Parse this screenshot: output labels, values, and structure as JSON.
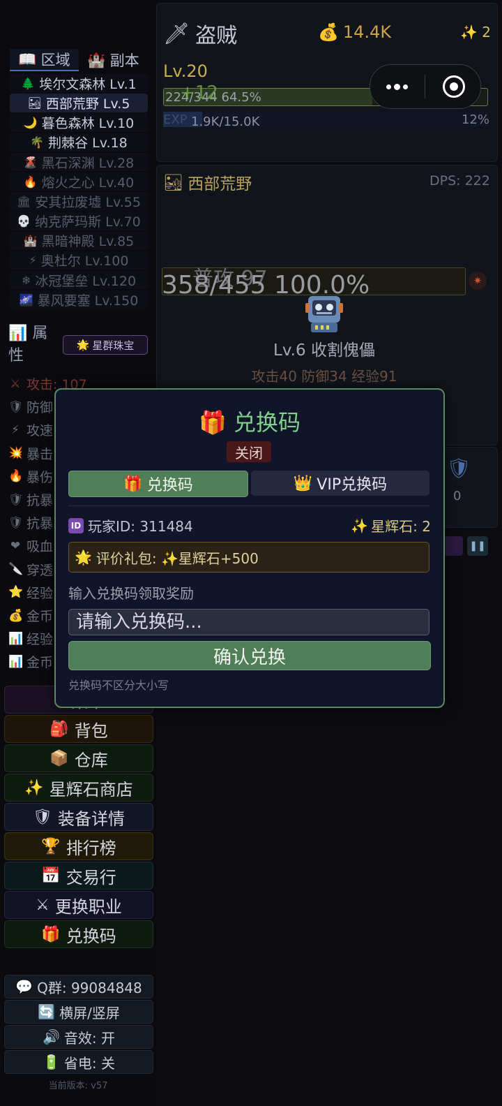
{
  "zone_tabs": [
    {
      "icon": "📖",
      "label": "区域"
    },
    {
      "icon": "🏰",
      "label": "副本"
    }
  ],
  "zones": [
    {
      "icon": "🌲",
      "label": "埃尔文森林 Lv.1",
      "state": "normal"
    },
    {
      "icon": "🏜",
      "label": "西部荒野 Lv.5",
      "state": "active"
    },
    {
      "icon": "🌙",
      "label": "暮色森林 Lv.10",
      "state": "normal"
    },
    {
      "icon": "🌴",
      "label": "荆棘谷 Lv.18",
      "state": "normal"
    },
    {
      "icon": "🌋",
      "label": "黑石深渊 Lv.28",
      "state": "locked"
    },
    {
      "icon": "🔥",
      "label": "熔火之心 Lv.40",
      "state": "locked"
    },
    {
      "icon": "🏛",
      "label": "安其拉废墟 Lv.55",
      "state": "locked"
    },
    {
      "icon": "💀",
      "label": "纳克萨玛斯 Lv.70",
      "state": "locked"
    },
    {
      "icon": "🏰",
      "label": "黑暗神殿 Lv.85",
      "state": "locked"
    },
    {
      "icon": "⚡",
      "label": "奥杜尔 Lv.100",
      "state": "locked"
    },
    {
      "icon": "❄",
      "label": "冰冠堡垒 Lv.120",
      "state": "locked"
    },
    {
      "icon": "🌌",
      "label": "暴风要塞 Lv.150",
      "state": "locked"
    }
  ],
  "attributes": {
    "title": "属性",
    "gem_button": "星群珠宝",
    "stats": [
      {
        "icon": "⚔",
        "label": "攻击: 107",
        "color": "#7a3a34"
      },
      {
        "icon": "🛡",
        "label": "防御",
        "color": "#6a6e7a"
      },
      {
        "icon": "⚡",
        "label": "攻速",
        "color": "#6a6e7a"
      },
      {
        "icon": "💥",
        "label": "暴击",
        "color": "#6a6e7a"
      },
      {
        "icon": "🔥",
        "label": "暴伤",
        "color": "#6a6e7a"
      },
      {
        "icon": "🛡",
        "label": "抗暴",
        "color": "#6a6e7a"
      },
      {
        "icon": "🛡",
        "label": "抗暴",
        "color": "#6a6e7a"
      },
      {
        "icon": "❤",
        "label": "吸血",
        "color": "#6a6e7a"
      },
      {
        "icon": "🔪",
        "label": "穿透",
        "color": "#6a6e7a"
      },
      {
        "icon": "⭐",
        "label": "经验",
        "color": "#6a6e7a"
      },
      {
        "icon": "💰",
        "label": "金币",
        "color": "#6a6e7a"
      },
      {
        "icon": "📊",
        "label": "经验",
        "color": "#6a6e7a"
      },
      {
        "icon": "📊",
        "label": "金币",
        "color": "#6a6e7a"
      }
    ]
  },
  "menu": [
    {
      "icon": "⚫",
      "label": "集市",
      "bg": "#1a1024",
      "border": "#33203f"
    },
    {
      "icon": "🎒",
      "label": "背包",
      "bg": "#1e1608",
      "border": "#3a2c12"
    },
    {
      "icon": "📦",
      "label": "仓库",
      "bg": "#0f1a10",
      "border": "#1f331f"
    },
    {
      "icon": "✨",
      "label": "星辉石商店",
      "bg": "#0f1a10",
      "border": "#1f331f"
    },
    {
      "icon": "🛡",
      "label": "装备详情",
      "bg": "#131626",
      "border": "#262a44"
    },
    {
      "icon": "🏆",
      "label": "排行榜",
      "bg": "#1e1a08",
      "border": "#3a3212"
    },
    {
      "icon": "📅",
      "label": "交易行",
      "bg": "#0c1a1c",
      "border": "#1a3236"
    },
    {
      "icon": "⚔",
      "label": "更换职业",
      "bg": "#141226",
      "border": "#282444"
    },
    {
      "icon": "🎁",
      "label": "兑换码",
      "bg": "#0f1a10",
      "border": "#1f331f"
    }
  ],
  "utilities": [
    {
      "icon": "💬",
      "label": "Q群: 99084848"
    },
    {
      "icon": "🔄",
      "label": "横屏/竖屏"
    },
    {
      "icon": "🔊",
      "label": "音效: 开"
    },
    {
      "icon": "🔋",
      "label": "省电: 关"
    }
  ],
  "version": "当前版本: v57",
  "hero": {
    "icon": "🗡",
    "class_name": "盗贼",
    "gold": "14.4K",
    "gold_icon": "💰",
    "stars": "✨ 2",
    "level": "Lv.20",
    "hp_text": "224/344  64.5%",
    "hp_overlay": "+12",
    "hp_fraction": 0.645,
    "exp_label": "EXP",
    "exp_text": "1.9K/15.0K",
    "exp_pct": "12%",
    "exp_fraction": 0.12
  },
  "battle": {
    "area_icon": "🏜",
    "area_name": "西部荒野",
    "dps": "DPS: 222",
    "enemy_hp": "358/455  100.0%",
    "enemy_hp_fraction": 1.0,
    "attack_text": "普攻  97",
    "enemy_name": "Lv.6 收割傀儡",
    "enemy_stats": "攻击40 防御34 经验91",
    "shield_value": "0"
  },
  "modal": {
    "title": "兑换码",
    "title_icon": "🎁",
    "close_label": "关闭",
    "tabs": [
      {
        "icon": "🎁",
        "label": "兑换码"
      },
      {
        "icon": "👑",
        "label": "VIP兑换码"
      }
    ],
    "player_id": "玩家ID: 311484",
    "stones": "星辉石: 2",
    "gift_text": "评价礼包: ✨星辉石+500",
    "hint": "输入兑换码领取奖励",
    "input_placeholder": "请输入兑换码...",
    "confirm_label": "确认兑换",
    "note": "兑换码不区分大小写"
  },
  "colors": {
    "modal_border": "#5a8a62",
    "accent_green": "#4f7e57",
    "gold": "#c9a34a"
  }
}
